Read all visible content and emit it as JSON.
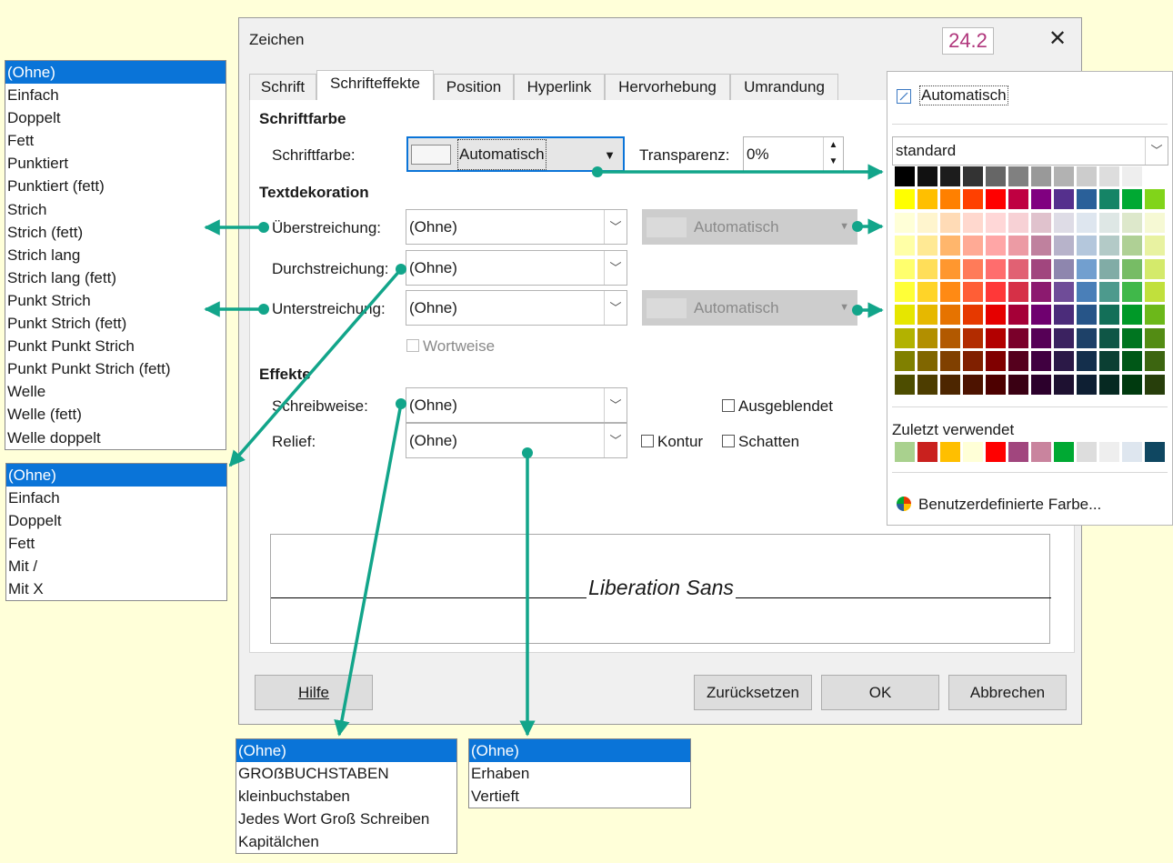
{
  "dialog": {
    "title": "Zeichen",
    "version": "24.2",
    "tabs": [
      "Schrift",
      "Schrifteffekte",
      "Position",
      "Hyperlink",
      "Hervorhebung",
      "Umrandung"
    ],
    "font_color": {
      "heading": "Schriftfarbe",
      "label": "Schriftfarbe:",
      "value": "Automatisch",
      "transparency_label": "Transparenz:",
      "transparency_value": "0%"
    },
    "text_decoration": {
      "heading": "Textdekoration",
      "overline_label": "Überstreichung:",
      "overline_value": "(Ohne)",
      "overline_color": "Automatisch",
      "strikethrough_label": "Durchstreichung:",
      "strikethrough_value": "(Ohne)",
      "underline_label": "Unterstreichung:",
      "underline_value": "(Ohne)",
      "underline_color": "Automatisch",
      "word_by_word": "Wortweise"
    },
    "effects": {
      "heading": "Effekte",
      "case_label": "Schreibweise:",
      "case_value": "(Ohne)",
      "relief_label": "Relief:",
      "relief_value": "(Ohne)",
      "hidden": "Ausgeblendet",
      "outline": "Kontur",
      "shadow": "Schatten"
    },
    "preview_text": "Liberation Sans",
    "buttons": {
      "help": "Hilfe",
      "reset": "Zurücksetzen",
      "ok": "OK",
      "cancel": "Abbrechen"
    }
  },
  "color_popup": {
    "automatic": "Automatisch",
    "palette_name": "standard",
    "recent_label": "Zuletzt verwendet",
    "custom_color": "Benutzerdefinierte Farbe...",
    "palette": [
      [
        "#000000",
        "#111111",
        "#1c1c1c",
        "#333333",
        "#666666",
        "#808080",
        "#999999",
        "#b2b2b2",
        "#cccccc",
        "#dddddd",
        "#eeeeee",
        "#ffffff"
      ],
      [
        "#ffff00",
        "#ffbf00",
        "#ff8000",
        "#ff4000",
        "#ff0000",
        "#bf0041",
        "#800080",
        "#55308d",
        "#2a6099",
        "#158466",
        "#00a933",
        "#81d41a"
      ],
      [
        "#ffffd7",
        "#fff5ce",
        "#ffdbb6",
        "#ffd8ce",
        "#ffd7d7",
        "#f7d1d5",
        "#e0c2cd",
        "#dedce6",
        "#dee6ef",
        "#dee7e5",
        "#dde8cb",
        "#f6f9d4"
      ],
      [
        "#ffffa6",
        "#ffe994",
        "#ffb66c",
        "#ffaa95",
        "#ffa6a6",
        "#ec9ba4",
        "#bf819e",
        "#b7b3ca",
        "#b4c7dc",
        "#b3cac7",
        "#afd095",
        "#e8f2a1"
      ],
      [
        "#ffff6d",
        "#ffde59",
        "#ff972f",
        "#ff7b59",
        "#ff6d6d",
        "#e16173",
        "#a1467e",
        "#8e86ae",
        "#729fcf",
        "#81aca6",
        "#77bc65",
        "#d4ea6b"
      ],
      [
        "#ffff38",
        "#ffd428",
        "#ff8a14",
        "#ff5e36",
        "#ff3838",
        "#d63047",
        "#8c1a6f",
        "#6f4c98",
        "#4a7fb8",
        "#4d9a8d",
        "#40b84a",
        "#c1e03c"
      ],
      [
        "#e6e600",
        "#e6b800",
        "#e67300",
        "#e63900",
        "#e60000",
        "#a50037",
        "#6f006f",
        "#4b2c7a",
        "#275588",
        "#136f58",
        "#009928",
        "#6cb81a"
      ],
      [
        "#b2b200",
        "#b28f00",
        "#b25900",
        "#b22c00",
        "#b20000",
        "#7a002a",
        "#560056",
        "#3b2260",
        "#1e4168",
        "#0f5646",
        "#007520",
        "#538c14"
      ],
      [
        "#808000",
        "#806600",
        "#804000",
        "#802000",
        "#800000",
        "#55001d",
        "#400040",
        "#2b1947",
        "#142f4c",
        "#0b3f33",
        "#005717",
        "#3c6510"
      ],
      [
        "#4d4d00",
        "#4d3d00",
        "#4d2600",
        "#4d1300",
        "#4d0000",
        "#3a0013",
        "#2c002c",
        "#1e1131",
        "#0e1f33",
        "#062922",
        "#003a0f",
        "#273e0b"
      ]
    ],
    "recent": [
      "#a9d18e",
      "#c9211e",
      "#ffbf00",
      "#ffffd7",
      "#ff0000",
      "#a1467e",
      "#c9849e",
      "#00a933",
      "#dddddd",
      "#eeeeee",
      "#dee6ef",
      "#0f4761"
    ]
  },
  "lists": {
    "overline_underline": [
      "(Ohne)",
      "Einfach",
      "Doppelt",
      "Fett",
      "Punktiert",
      "Punktiert (fett)",
      "Strich",
      "Strich (fett)",
      "Strich lang",
      "Strich lang (fett)",
      "Punkt Strich",
      "Punkt Strich (fett)",
      "Punkt Punkt Strich",
      "Punkt Punkt Strich (fett)",
      "Welle",
      "Welle (fett)",
      "Welle doppelt"
    ],
    "strikethrough": [
      "(Ohne)",
      "Einfach",
      "Doppelt",
      "Fett",
      "Mit /",
      "Mit X"
    ],
    "case": [
      "(Ohne)",
      "GROẞBUCHSTABEN",
      "kleinbuchstaben",
      "Jedes Wort Groß Schreiben",
      "Kapitälchen"
    ],
    "relief": [
      "(Ohne)",
      "Erhaben",
      "Vertieft"
    ]
  },
  "colors": {
    "background": "#ffffd9",
    "selection": "#0a74d8",
    "connector": "#12a58a",
    "version_text": "#b0367c"
  }
}
